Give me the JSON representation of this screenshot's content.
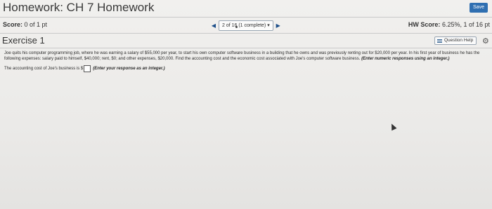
{
  "header": {
    "title": "Homework: CH 7 Homework",
    "save_label": "Save"
  },
  "score_bar": {
    "score_label": "Score:",
    "score_value": "0 of 1 pt",
    "question_selector": "2 of 16 (1 complete)",
    "hw_score_label": "HW Score:",
    "hw_score_value": "6.25%, 1 of 16 pt"
  },
  "exercise": {
    "title": "Exercise 1",
    "help_label": "Question Help"
  },
  "problem": {
    "text": "Joe quits his computer programming job, where he was earning a salary of $55,000 per year, to start his own computer software business in a building that he owns and was previously renting out for $20,000 per year. In his first year of business he has the following expenses: salary paid to himself, $40,000; rent, $0; and other expenses, $20,000. Find the accounting cost and the economic cost associated with Joe's computer software business.",
    "hint": "(Enter numeric responses using an integer.)",
    "answer_prompt": "The accounting cost of Joe's business is $",
    "answer_value": "",
    "answer_hint": "(Enter your response as an integer.)"
  },
  "icons": {
    "prev": "triangle-left-icon",
    "next": "triangle-right-icon",
    "dropdown": "caret-down-icon",
    "help": "list-icon",
    "settings": "gear-icon"
  }
}
